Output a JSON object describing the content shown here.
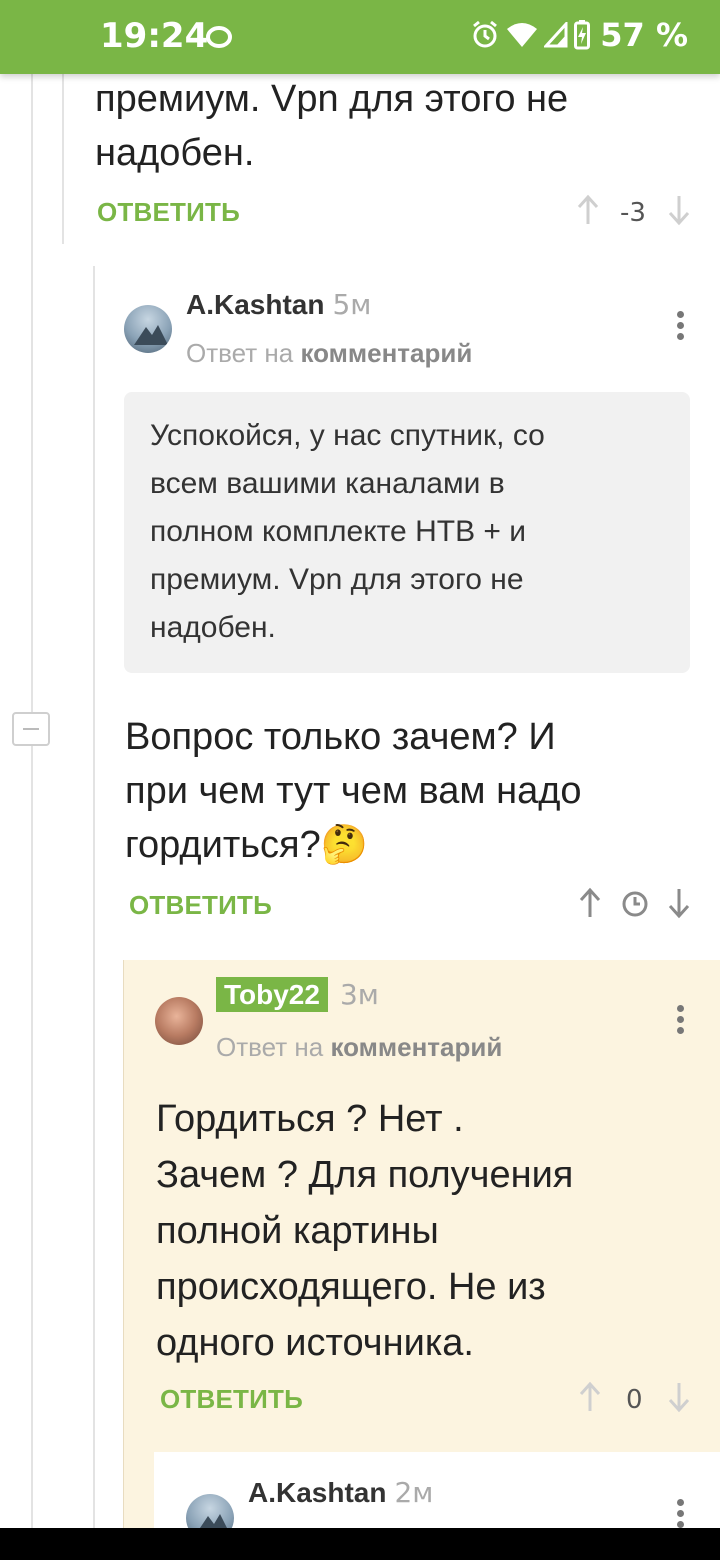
{
  "status_bar": {
    "time": "19:24",
    "battery": "57 %",
    "icons": [
      "vpn-icon",
      "alarm-icon",
      "wifi-icon",
      "signal-icon",
      "battery-charging-icon"
    ],
    "color": "#7ab646"
  },
  "comments": [
    {
      "text_lines": [
        "премиум. Vpn для этого не",
        "надобен."
      ],
      "reply_label": "ОТВЕТИТЬ",
      "score": "-3"
    },
    {
      "author": "A.Kashtan",
      "time": "5м",
      "reply_prefix": "Ответ на",
      "reply_target": "комментарий",
      "quote_lines": [
        "Успокойся, у нас спутник, со",
        "всем вашими каналами в",
        "полном комплекте НТВ + и",
        "премиум. Vpn для этого не",
        "надобен."
      ],
      "text_lines": [
        "Вопрос только зачем? И",
        "при чем тут чем вам надо",
        "гордиться?🤔"
      ],
      "reply_label": "ОТВЕТИТЬ"
    },
    {
      "author": "Toby22",
      "time": "3м",
      "reply_prefix": "Ответ на",
      "reply_target": "комментарий",
      "text_lines": [
        "Гордиться ? Нет .",
        "Зачем ? Для получения",
        "полной картины",
        "происходящего. Не из",
        "одного источника."
      ],
      "reply_label": "ОТВЕТИТЬ",
      "score": "0"
    },
    {
      "author": "A.Kashtan",
      "time": "2м"
    }
  ],
  "colors": {
    "accent": "#7ab646",
    "highlight_bg": "#fcf4e0",
    "quote_bg": "#f1f1f1"
  }
}
